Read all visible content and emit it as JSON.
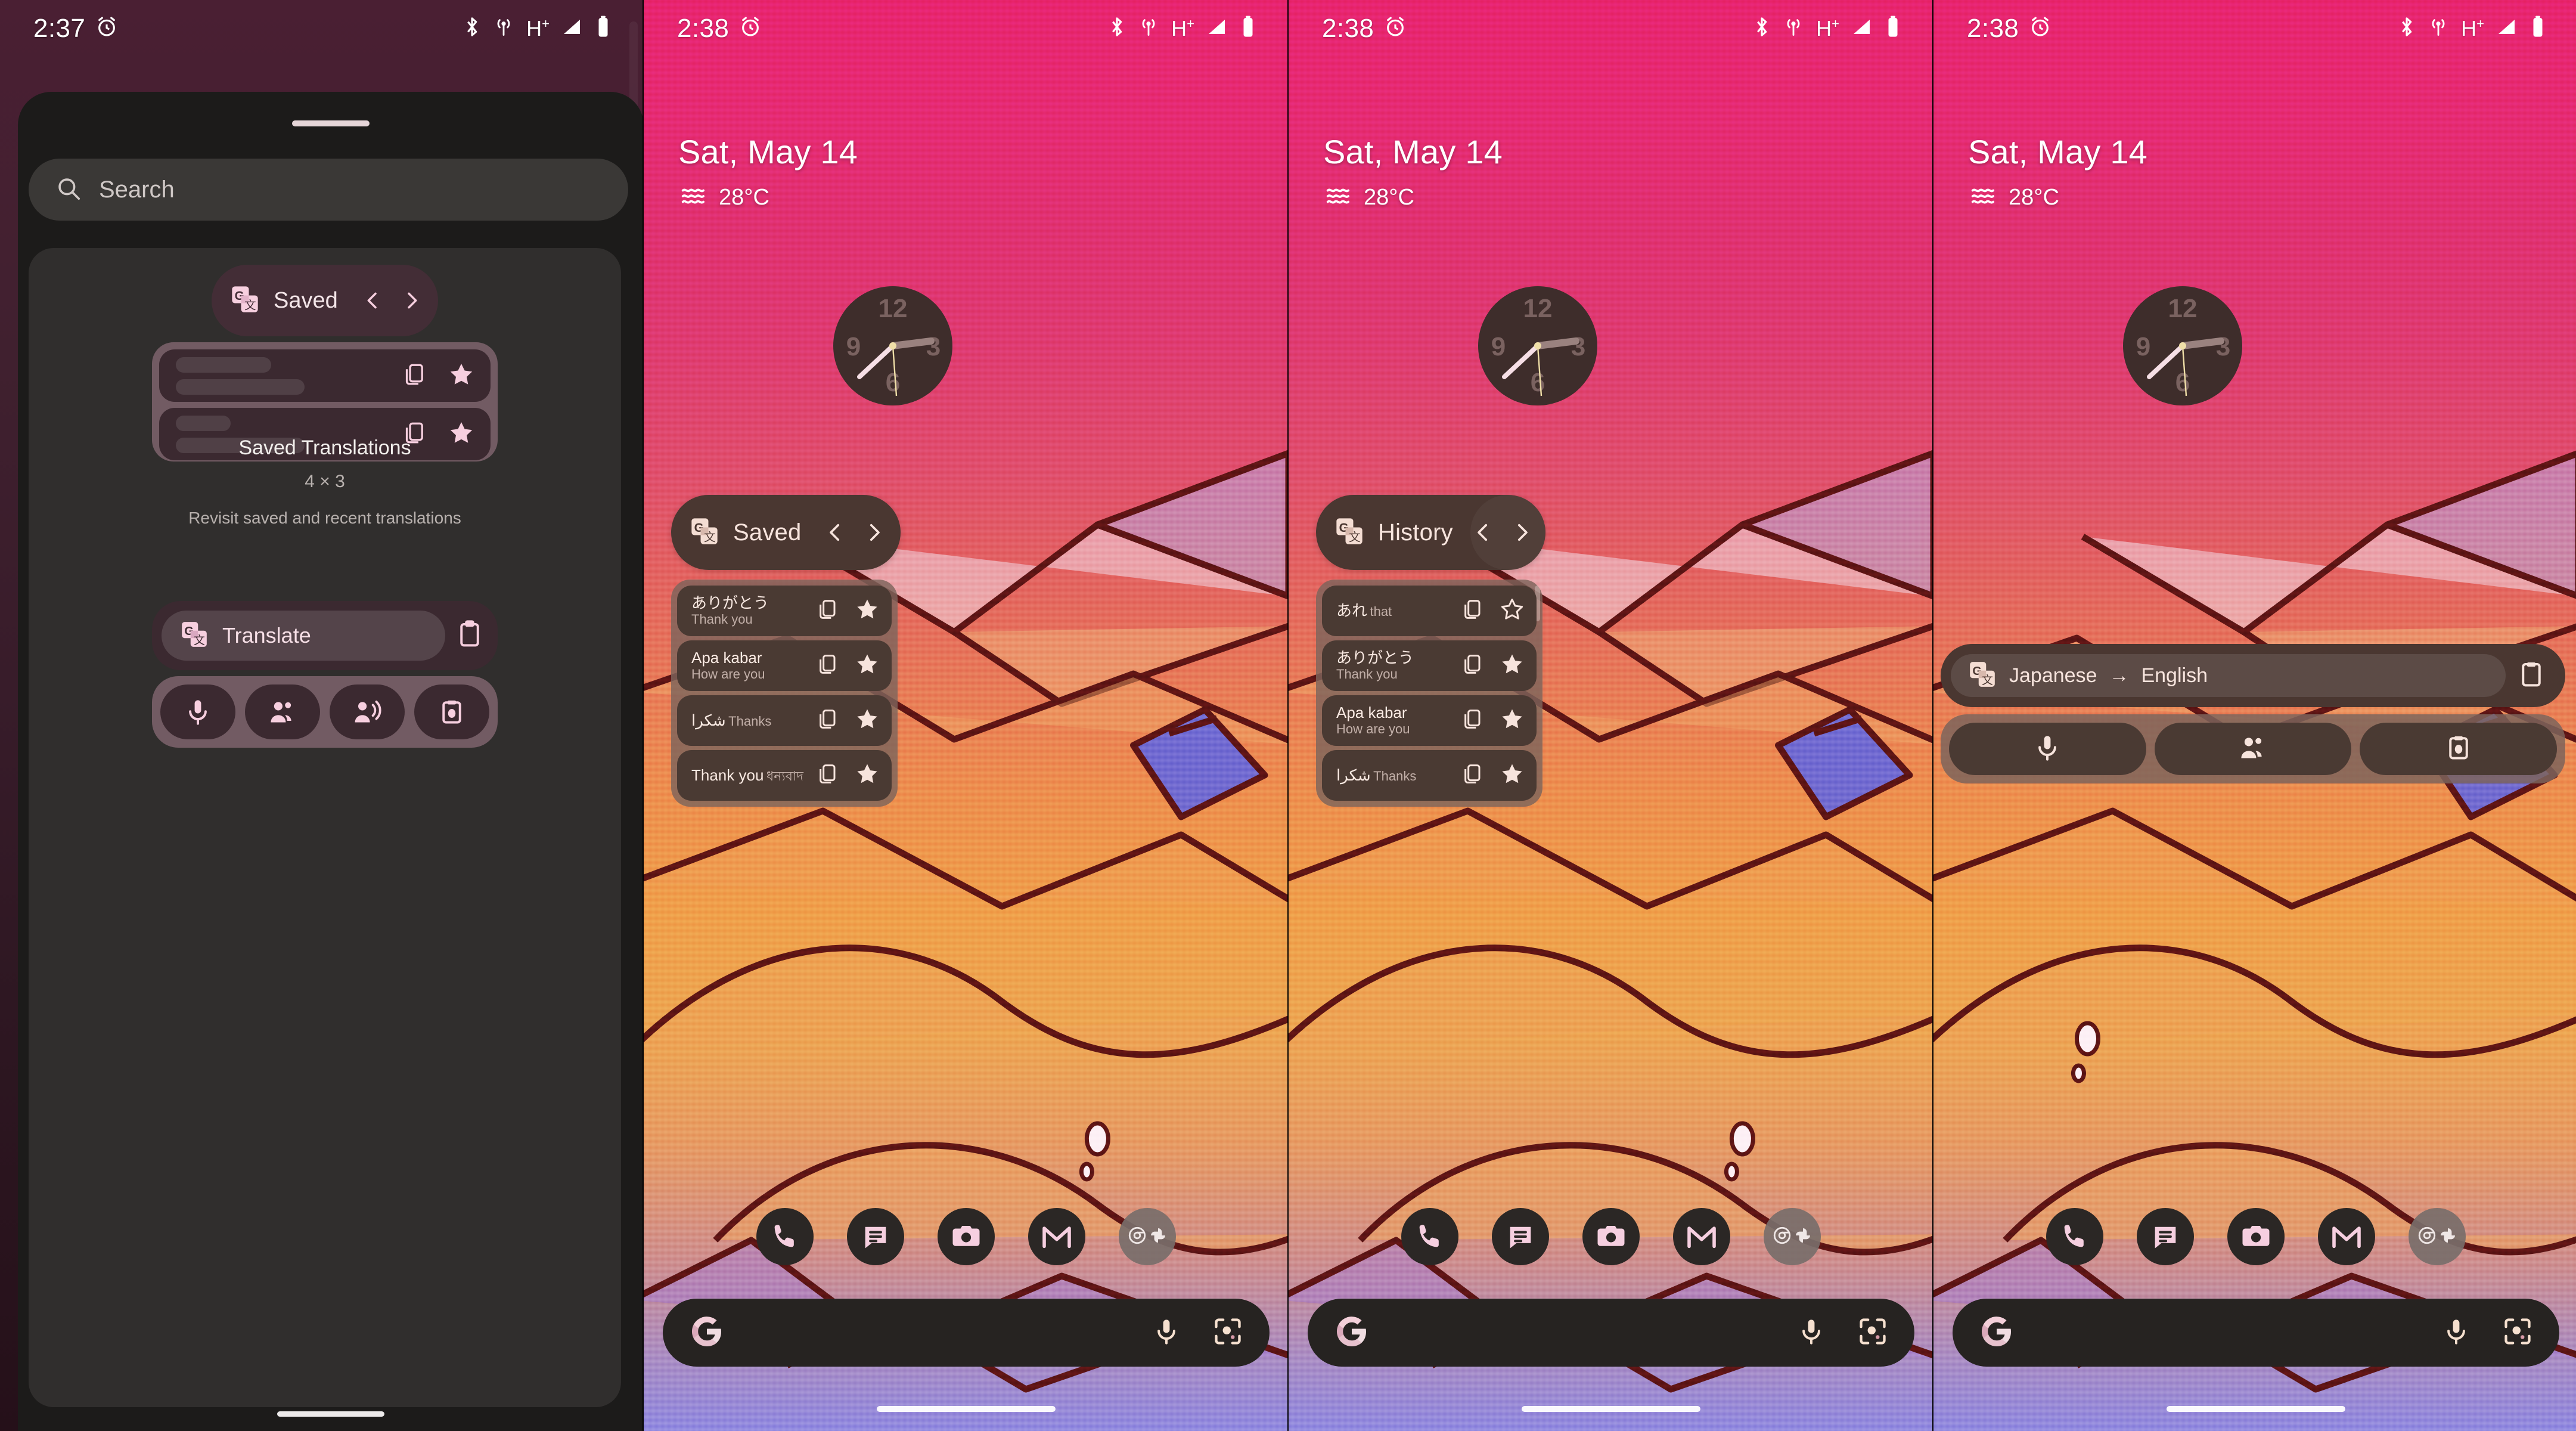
{
  "screens": [
    {
      "id": "widget-picker",
      "status_bar": {
        "time": "2:37",
        "icons": [
          "alarm-icon",
          "bluetooth-icon",
          "hotspot-icon",
          "network-hplus-icon",
          "signal-icon",
          "battery-icon"
        ],
        "network_label": "H",
        "network_sup": "+"
      },
      "sheet": {
        "search": {
          "placeholder": "Search",
          "value": "",
          "icon": "search-icon"
        },
        "widget_preview": {
          "app_icon": "google-translate-icon",
          "header_title": "Saved",
          "prev_icon": "chevron-left-icon",
          "next_icon": "chevron-right-icon",
          "rows": [
            {
              "copy_icon": "copy-icon",
              "star_icon": "star-filled-icon"
            },
            {
              "copy_icon": "copy-icon",
              "star_icon": "star-filled-icon"
            }
          ]
        },
        "widget_meta": {
          "name": "Saved Translations",
          "size": "4 × 3",
          "description": "Revisit saved and recent translations"
        },
        "widget_preview_2": {
          "app_icon": "google-translate-icon",
          "label": "Translate",
          "clipboard_icon": "clipboard-icon",
          "buttons": [
            "microphone-icon",
            "conversation-icon",
            "transcribe-icon",
            "camera-clipboard-icon"
          ]
        }
      }
    },
    {
      "id": "home-saved",
      "status_bar": {
        "time": "2:38",
        "network_label": "H",
        "network_sup": "+"
      },
      "smartspace": {
        "date": "Sat, May 14",
        "temperature": "28°C",
        "weather_icon": "haze-icon"
      },
      "clock": {
        "numerals": [
          "12",
          "3",
          "6",
          "9"
        ],
        "type": "analog-clock"
      },
      "translate_widget": {
        "app_icon": "google-translate-icon",
        "title": "Saved",
        "prev_icon": "chevron-left-icon",
        "next_icon": "chevron-right-icon",
        "has_scrollbar": false,
        "items": [
          {
            "source": "ありがとう",
            "target": "Thank you",
            "copy_icon": "copy-icon",
            "star_icon": "star-filled-icon"
          },
          {
            "source": "Apa kabar",
            "target": "How are you",
            "copy_icon": "copy-icon",
            "star_icon": "star-filled-icon"
          },
          {
            "source": "شكرا",
            "target": "Thanks",
            "copy_icon": "copy-icon",
            "star_icon": "star-filled-icon"
          },
          {
            "source": "Thank you",
            "target": "ধন্যবাদ",
            "copy_icon": "copy-icon",
            "star_icon": "star-filled-icon"
          }
        ]
      },
      "dock": [
        {
          "name": "phone-app-icon"
        },
        {
          "name": "messages-app-icon"
        },
        {
          "name": "camera-app-icon"
        },
        {
          "name": "gmail-app-icon"
        },
        {
          "name": "app-folder",
          "contents": [
            "chrome-icon",
            "photos-icon"
          ]
        }
      ],
      "search_bar": {
        "logo": "google-g-icon",
        "mic_icon": "microphone-icon",
        "lens_icon": "google-lens-icon",
        "value": ""
      }
    },
    {
      "id": "home-history",
      "status_bar": {
        "time": "2:38",
        "network_label": "H",
        "network_sup": "+"
      },
      "smartspace": {
        "date": "Sat, May 14",
        "temperature": "28°C",
        "weather_icon": "haze-icon"
      },
      "clock": {
        "numerals": [
          "12",
          "3",
          "6",
          "9"
        ],
        "type": "analog-clock"
      },
      "translate_widget": {
        "app_icon": "google-translate-icon",
        "title": "History",
        "prev_icon": "chevron-left-icon",
        "next_icon": "chevron-right-icon",
        "has_scrollbar": true,
        "items": [
          {
            "source": "あれ",
            "target": "that",
            "copy_icon": "copy-icon",
            "star_icon": "star-outline-icon"
          },
          {
            "source": "ありがとう",
            "target": "Thank you",
            "copy_icon": "copy-icon",
            "star_icon": "star-filled-icon"
          },
          {
            "source": "Apa kabar",
            "target": "How are you",
            "copy_icon": "copy-icon",
            "star_icon": "star-filled-icon"
          },
          {
            "source": "شكرا",
            "target": "Thanks",
            "copy_icon": "copy-icon",
            "star_icon": "star-filled-icon"
          }
        ]
      },
      "dock": [
        {
          "name": "phone-app-icon"
        },
        {
          "name": "messages-app-icon"
        },
        {
          "name": "camera-app-icon"
        },
        {
          "name": "gmail-app-icon"
        },
        {
          "name": "app-folder",
          "contents": [
            "chrome-icon",
            "photos-icon"
          ]
        }
      ],
      "search_bar": {
        "logo": "google-g-icon",
        "mic_icon": "microphone-icon",
        "lens_icon": "google-lens-icon",
        "value": ""
      }
    },
    {
      "id": "home-quick-translate",
      "status_bar": {
        "time": "2:38",
        "network_label": "H",
        "network_sup": "+"
      },
      "smartspace": {
        "date": "Sat, May 14",
        "temperature": "28°C",
        "weather_icon": "haze-icon"
      },
      "clock": {
        "numerals": [
          "12",
          "3",
          "6",
          "9"
        ],
        "type": "analog-clock"
      },
      "quick_widget": {
        "app_icon": "google-translate-icon",
        "source_language": "Japanese",
        "arrow": "→",
        "target_language": "English",
        "clipboard_icon": "clipboard-icon",
        "buttons": [
          {
            "name": "voice-input-button",
            "icon": "microphone-icon"
          },
          {
            "name": "conversation-button",
            "icon": "conversation-icon"
          },
          {
            "name": "camera-translate-button",
            "icon": "camera-clipboard-icon"
          }
        ]
      },
      "dock": [
        {
          "name": "phone-app-icon"
        },
        {
          "name": "messages-app-icon"
        },
        {
          "name": "camera-app-icon"
        },
        {
          "name": "gmail-app-icon"
        },
        {
          "name": "app-folder",
          "contents": [
            "chrome-icon",
            "photos-icon"
          ]
        }
      ],
      "search_bar": {
        "logo": "google-g-icon",
        "mic_icon": "microphone-icon",
        "lens_icon": "google-lens-icon",
        "value": ""
      }
    }
  ],
  "colors": {
    "widget_surface": "#4a3731",
    "widget_row": "#4a3a33",
    "widget_list_bg": "#7d645c",
    "accent_text": "#f7e4dd",
    "secondary_text": "#c3b0a9",
    "sheet_bg": "#1c1b1a",
    "sheet_search": "#3a3836",
    "picker_body": "#302e2d",
    "picker_accent": "#f6dfe6",
    "dock_icon": "#2b2725",
    "search_pill": "#262321"
  }
}
